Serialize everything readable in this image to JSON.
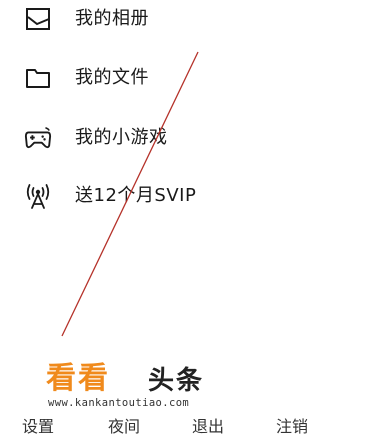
{
  "menu": {
    "items": [
      {
        "label": "我的相册",
        "icon": "photo-album-icon"
      },
      {
        "label": "我的文件",
        "icon": "folder-icon"
      },
      {
        "label": "我的小游戏",
        "icon": "gamepad-icon"
      },
      {
        "label": "送12个月SVIP",
        "icon": "broadcast-tower-icon"
      }
    ]
  },
  "watermark": {
    "logo_text": "看看",
    "logo_suffix": "头条",
    "url": "www.kankantoutiao.com",
    "logo_color": "#f08a1c"
  },
  "bottom_bar": {
    "items": [
      "设置",
      "夜间",
      "退出",
      "注销"
    ]
  },
  "colors": {
    "text": "#1a1a1a",
    "overlay_line": "#b5322a"
  }
}
